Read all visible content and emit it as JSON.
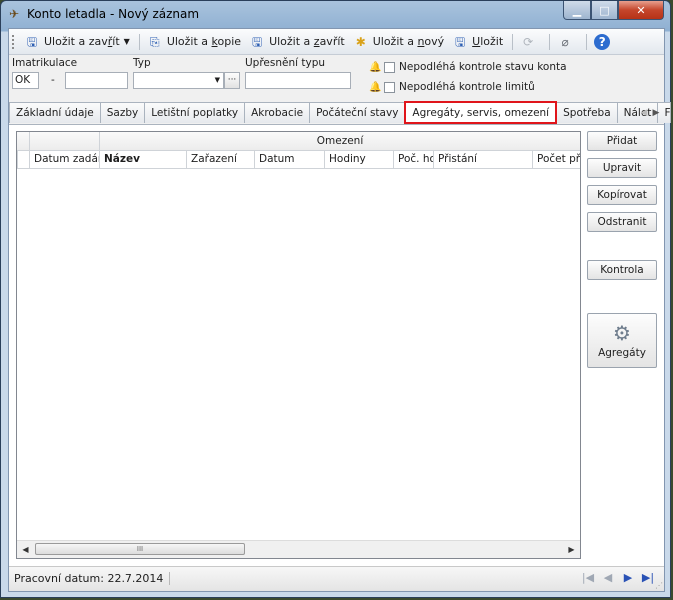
{
  "window": {
    "title": "Konto letadla  - Nový záznam",
    "min_label": "▁",
    "max_label": "□",
    "close_label": "✕"
  },
  "toolbar": {
    "save_close": {
      "pre": "Uložit a zav",
      "ul": "ř",
      "post": "ít"
    },
    "save_copy": {
      "pre": "Uložit a ",
      "ul": "k",
      "post": "opie"
    },
    "save_close2": {
      "pre": "Uložit a ",
      "ul": "z",
      "post": "avřít"
    },
    "save_new": {
      "pre": "Uložit a ",
      "ul": "n",
      "post": "ový"
    },
    "save": {
      "pre": "",
      "ul": "U",
      "post": "ložit"
    },
    "help_label": "?"
  },
  "form": {
    "imatrikulace_label": "Imatrikulace",
    "imatrikulace_prefix": "OK",
    "imatrikulace_dash": "-",
    "imatrikulace_value": "",
    "typ_label": "Typ",
    "typ_value": "",
    "typ_ellipsis": "···",
    "upresneni_label": "Upřesnění typu",
    "upresneni_value": "",
    "check1_label": "Nepodléhá kontrole stavu konta",
    "check2_label": "Nepodléhá kontrole limitů"
  },
  "tabs": [
    "Základní údaje",
    "Sazby",
    "Letištní poplatky",
    "Akrobacie",
    "Počáteční stavy",
    "Agregáty, servis, omezení",
    "Spotřeba",
    "Nálet",
    "Flight Offic"
  ],
  "active_tab_index": 5,
  "grid": {
    "band_label": "Omezení",
    "columns": [
      "Datum zadání",
      "Název",
      "Zařazení",
      "Datum",
      "Hodiny",
      "Poč. hodin",
      "Přistání",
      "Počet př."
    ],
    "thumb_glyph": "III"
  },
  "side_buttons": {
    "add": "Přidat",
    "edit": "Upravit",
    "copy": "Kopírovat",
    "remove": "Odstranit",
    "check": "Kontrola",
    "aggregates": "Agregáty"
  },
  "status": {
    "working_date": "Pracovní datum: 22.7.2014"
  },
  "colors": {
    "active_tab_border": "#e0151b",
    "nav_active": "#2a52b5"
  }
}
